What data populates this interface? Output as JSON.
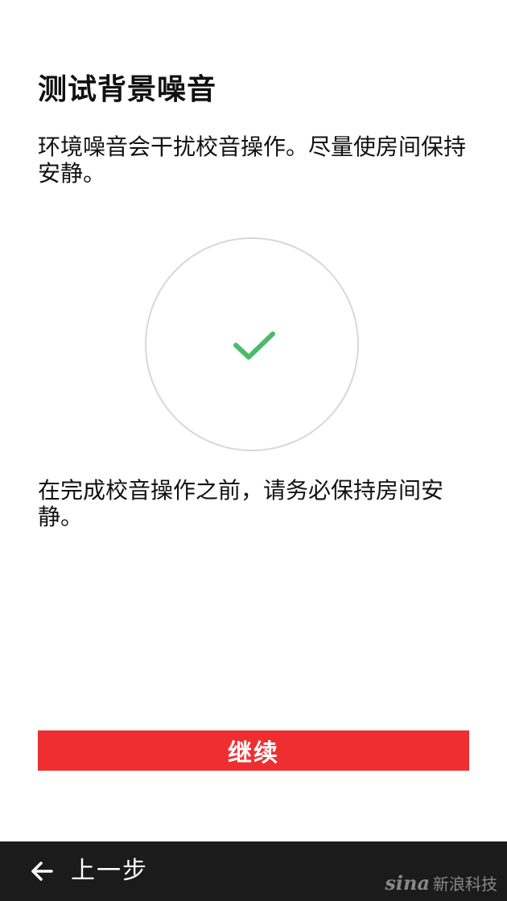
{
  "title": "测试背景噪音",
  "description": "环境噪音会干扰校音操作。尽量使房间保持安静。",
  "status": {
    "icon": "checkmark-icon",
    "color": "#4cba6b"
  },
  "instruction": "在完成校音操作之前，请务必保持房间安静。",
  "continue_button": {
    "label": "继续",
    "color": "#ef2e32"
  },
  "bottom_bar": {
    "back_label": "上一步",
    "back_icon": "arrow-left-icon"
  },
  "watermark": {
    "logo": "sina",
    "text": "新浪科技"
  }
}
